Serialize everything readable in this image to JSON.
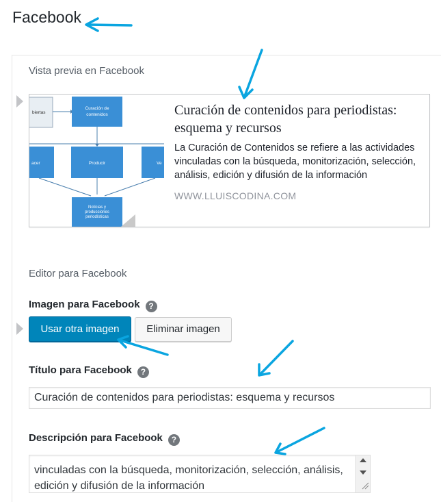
{
  "header": {
    "title": "Facebook"
  },
  "preview": {
    "label": "Vista previa en Facebook",
    "title": "Curación de contenidos para periodistas: esquema y recursos",
    "description": "La Curación de Contenidos se refiere a las actividades vinculadas con la búsqueda, monitorización, selección, análisis, edición y difusión de la información",
    "url": "WWW.LLUISCODINA.COM",
    "image": {
      "box_top_left": "biertas",
      "box_top": "Curación de\ncontenidos",
      "box_left": "acer",
      "box_center": "Producir",
      "box_right": "Ve",
      "box_bottom": "Noticias y\nproducciones\nperiodísticas"
    }
  },
  "editor": {
    "label": "Editor para Facebook",
    "image_label": "Imagen para Facebook",
    "use_other_image": "Usar otra imagen",
    "remove_image": "Eliminar imagen",
    "title_label": "Título para Facebook",
    "title_value": "Curación de contenidos para periodistas: esquema y recursos",
    "description_label": "Descripción para Facebook",
    "description_value": "vinculadas con la búsqueda, monitorización, selección, análisis, edición y difusión de la información",
    "help_glyph": "?"
  },
  "colors": {
    "primary_button": "#0085ba",
    "annotation_arrow": "#0aa5e0",
    "diagram_box": "#3a8fd6"
  }
}
